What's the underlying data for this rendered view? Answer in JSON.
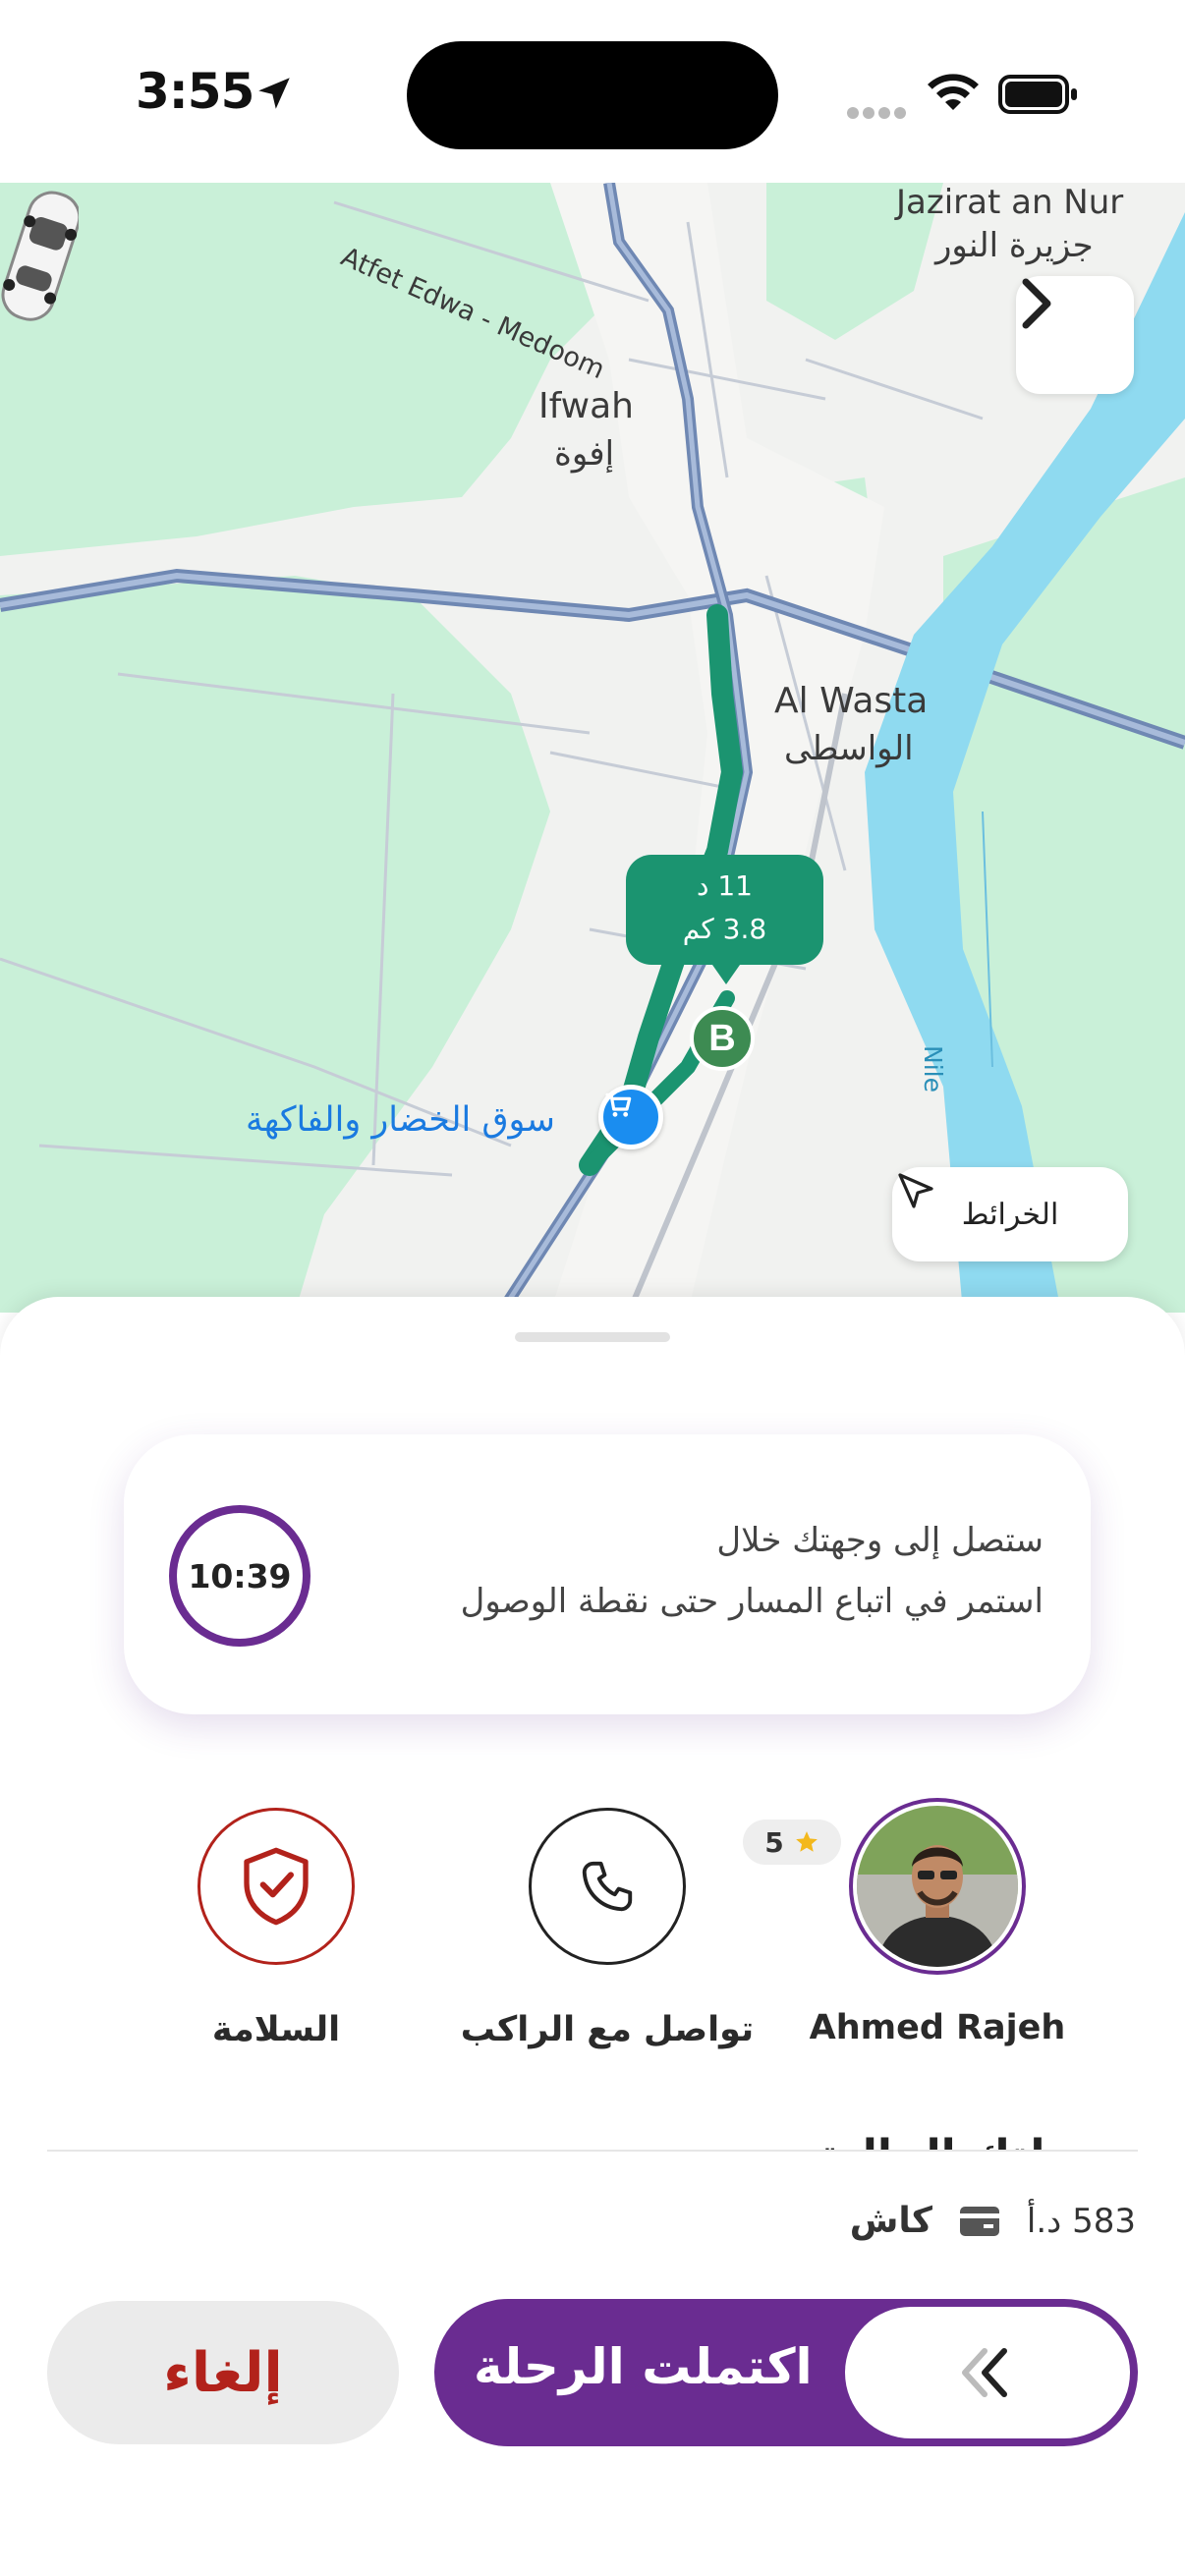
{
  "status_bar": {
    "time": "3:55"
  },
  "map": {
    "labels": {
      "jazirat_en": "Jazirat an Nur",
      "jazirat_ar": "جزيرة النور",
      "road": "Atfet Edwa - Medoom",
      "ifwah_en": "Ifwah",
      "ifwah_ar": "إفوة",
      "wasta_en": "Al Wasta",
      "wasta_ar": "الواسطى",
      "nile": "Nile"
    },
    "eta_bubble": {
      "minutes": "11 د",
      "distance": "3.8 كم"
    },
    "destination_marker": "B",
    "poi_label": "سوق الخضار والفاكهة",
    "maps_button_label": "الخرائط",
    "route_color": "#1b9470"
  },
  "sheet": {
    "eta_card": {
      "timer": "10:39",
      "line1": "ستصل إلى وجهتك خلال",
      "line2": "استمر في اتباع المسار حتى نقطة الوصول"
    },
    "actions": {
      "safety_label": "السلامة",
      "contact_label": "تواصل مع الراكب",
      "rider_name": "Ahmed Rajeh",
      "rider_rating": "5"
    },
    "partial_heading": "رحلتك الحالية",
    "payment": {
      "amount": "583 د.أ",
      "method": "كاش"
    },
    "buttons": {
      "cancel": "إلغاء",
      "complete": "اكتملت الرحلة"
    }
  },
  "colors": {
    "brand_purple": "#6a2c91",
    "cancel_red": "#b2221b",
    "route_green": "#1b9470"
  }
}
